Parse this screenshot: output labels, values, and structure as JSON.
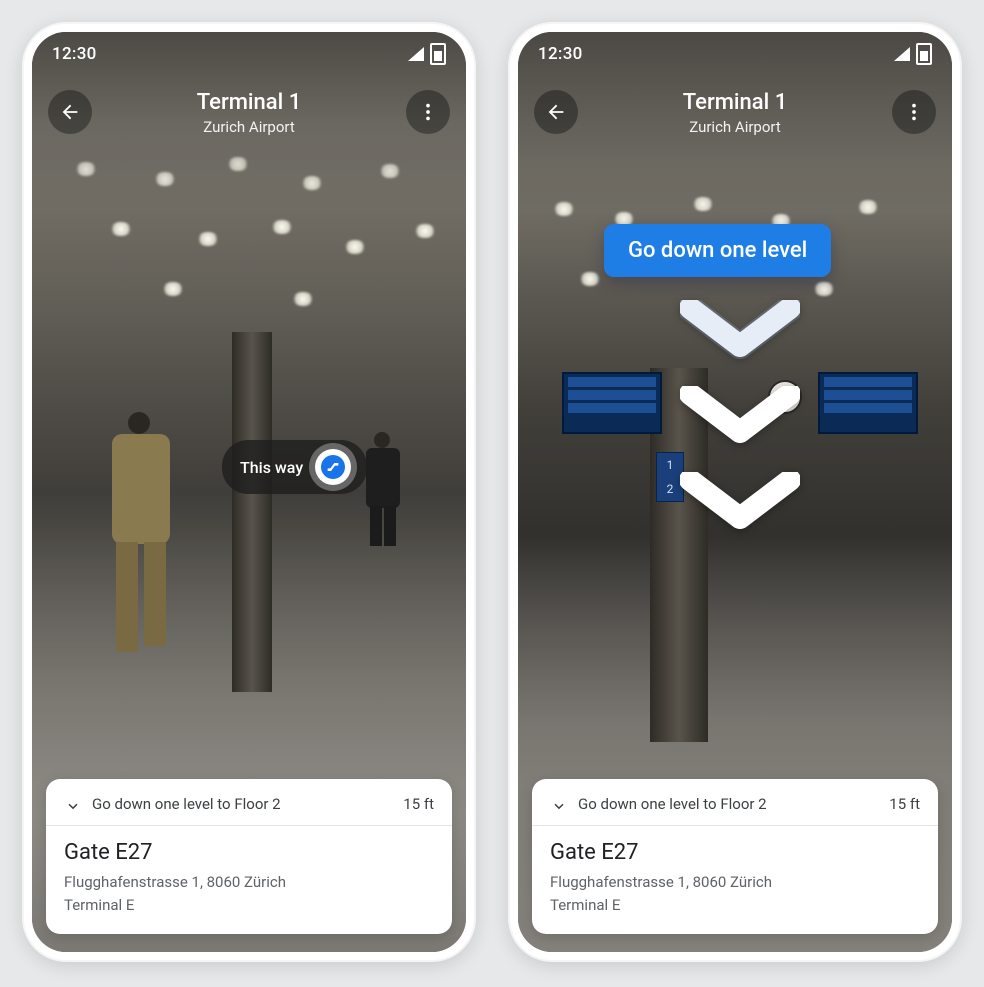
{
  "statusbar": {
    "time": "12:30"
  },
  "header": {
    "title": "Terminal 1",
    "subtitle": "Zurich Airport"
  },
  "left_ar": {
    "pill_text": "This way"
  },
  "right_ar": {
    "banner_text": "Go down one level"
  },
  "card": {
    "instruction": "Go down one level to Floor 2",
    "distance": "15 ft",
    "destination_title": "Gate E27",
    "destination_address": "Flugghafenstrasse 1, 8060 Zürich",
    "destination_terminal": "Terminal E"
  }
}
